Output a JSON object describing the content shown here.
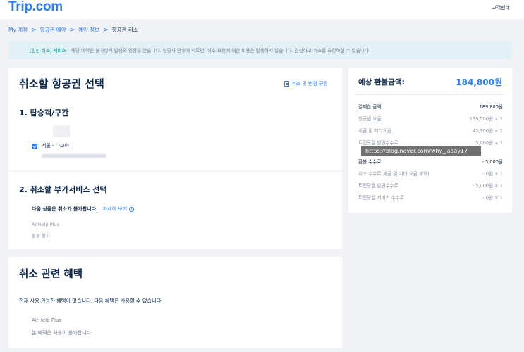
{
  "header": {
    "logo": "Trip.com",
    "help_label": "고객센터"
  },
  "breadcrumb": {
    "items": [
      "My 계정",
      "항공권 예약",
      "예약 정보",
      "항공권 취소"
    ],
    "separator": ">"
  },
  "notice": {
    "tag": "[안심 취소] 서비스",
    "text": "해당 예약은 불가항력 발생의 영향을 받습니다. 항공사 안내에 따르면, 취소 요청에 대한 비용은 발생하지 않습니다. 안심하고 취소를 요청하실 수 있습니다."
  },
  "select_card": {
    "title": "취소할 항공권 선택",
    "rules_link": "취소 및 변경 규정",
    "section1_title": "1.  탑승객/구간",
    "route": "서울 - 나고야",
    "section2_title": "2.  취소할 부가서비스 선택",
    "noncancel_label": "다음 상품은 취소가 불가합니다.",
    "detail_link": "자세히 보기",
    "addon_name": "AirHelp Plus",
    "addon_status": "환불 불가"
  },
  "refund": {
    "title": "예상 환불금액:",
    "total": "184,800원",
    "rows": [
      {
        "label": "결제한 금액",
        "value": "189,800원",
        "strong": true
      },
      {
        "label": "항공권 요금",
        "value": "139,500원 × 1"
      },
      {
        "label": "세금 및 기타요금",
        "value": "45,300원 × 1"
      },
      {
        "label": "트립닷컴 발권수수료",
        "value": "5,000원 × 1"
      },
      {
        "label": "환불 수수료",
        "value": "- 5,000원",
        "strong": true
      },
      {
        "label": "취소 수수료(세금 및 기타 요금 제외)",
        "value": "- 0원 × 1"
      },
      {
        "label": "트립닷컴 발권수수료",
        "value": "- 5,000원 × 1"
      },
      {
        "label": "트립닷컴 서비스 수수료",
        "value": "- 0원 × 1"
      }
    ],
    "watermark": "https://blog.naver.com/why_jaaay17"
  },
  "benefit_card": {
    "title": "취소 관련 혜택",
    "text": "현재 사용 가능한 혜택이 없습니다. 다음 혜택은 사용할 수 없습니다:",
    "item_name": "AirHelp Plus",
    "item_status": "본 혜택은 사용이 불가합니다"
  },
  "colors": {
    "brand": "#287dfa",
    "notice_bg": "#e1f1f6",
    "notice_tag": "#00918a",
    "text": "#0f294d",
    "muted": "#8592a6"
  }
}
